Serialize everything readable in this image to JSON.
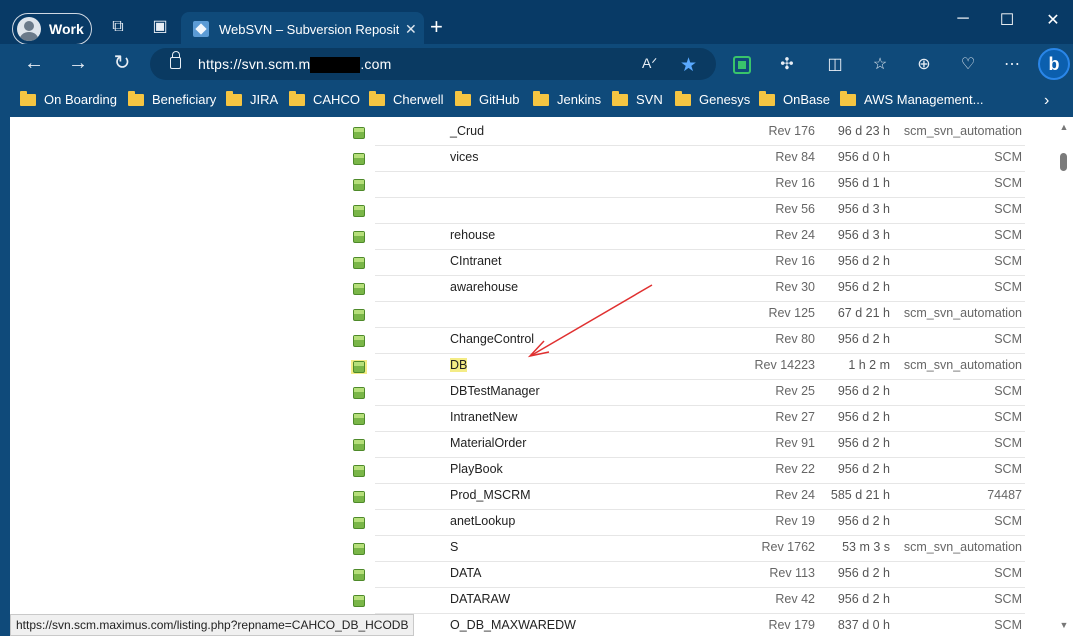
{
  "titlebar": {
    "profile_label": "Work",
    "tab_title": "WebSVN – Subversion Repository",
    "new_tab_icon": "plus-icon",
    "minimize_icon": "minimize-icon",
    "maximize_icon": "maximize-icon",
    "close_icon": "close-icon"
  },
  "toolbar": {
    "url_start": "https://svn.scm.",
    "url_partial": "m",
    "url_end": ".com",
    "icons": [
      "read-aloud-icon",
      "favorite-star-icon",
      "extension-icon",
      "puzzle-icon",
      "split-screen-icon",
      "favorites-icon",
      "collections-icon",
      "heart-icon",
      "more-icon",
      "bing-icon"
    ]
  },
  "bookmarks": [
    {
      "label": "On Boarding"
    },
    {
      "label": "Beneficiary"
    },
    {
      "label": "JIRA"
    },
    {
      "label": "CAHCO"
    },
    {
      "label": "Cherwell"
    },
    {
      "label": "GitHub"
    },
    {
      "label": "Jenkins"
    },
    {
      "label": "SVN"
    },
    {
      "label": "Genesys"
    },
    {
      "label": "OnBase"
    },
    {
      "label": "AWS Management..."
    }
  ],
  "colors": {
    "chrome_bg": "#0f4a7a",
    "titlebar_bg": "#083a66",
    "highlight": "#f4ec86",
    "arrow": "#e03030"
  },
  "repos": [
    {
      "name": "_Crud",
      "rev": "Rev 176",
      "age": "96 d 23 h",
      "author": "scm_svn_automation"
    },
    {
      "name": "vices",
      "rev": "Rev 84",
      "age": "956 d 0 h",
      "author": "SCM"
    },
    {
      "name": "",
      "rev": "Rev 16",
      "age": "956 d 1 h",
      "author": "SCM"
    },
    {
      "name": "",
      "rev": "Rev 56",
      "age": "956 d 3 h",
      "author": "SCM"
    },
    {
      "name": "rehouse",
      "rev": "Rev 24",
      "age": "956 d 3 h",
      "author": "SCM"
    },
    {
      "name": "CIntranet",
      "rev": "Rev 16",
      "age": "956 d 2 h",
      "author": "SCM"
    },
    {
      "name": "awarehouse",
      "rev": "Rev 30",
      "age": "956 d 2 h",
      "author": "SCM"
    },
    {
      "name": "",
      "rev": "Rev 125",
      "age": "67 d 21 h",
      "author": "scm_svn_automation"
    },
    {
      "name": "ChangeControl",
      "rev": "Rev 80",
      "age": "956 d 2 h",
      "author": "SCM"
    },
    {
      "name": "DB",
      "rev": "Rev 14223",
      "age": "1 h 2 m",
      "author": "scm_svn_automation",
      "highlight": true
    },
    {
      "name": "DBTestManager",
      "rev": "Rev 25",
      "age": "956 d 2 h",
      "author": "SCM"
    },
    {
      "name": "IntranetNew",
      "rev": "Rev 27",
      "age": "956 d 2 h",
      "author": "SCM"
    },
    {
      "name": "MaterialOrder",
      "rev": "Rev 91",
      "age": "956 d 2 h",
      "author": "SCM"
    },
    {
      "name": "PlayBook",
      "rev": "Rev 22",
      "age": "956 d 2 h",
      "author": "SCM"
    },
    {
      "name": "Prod_MSCRM",
      "rev": "Rev 24",
      "age": "585 d 21 h",
      "author": "74487"
    },
    {
      "name": "anetLookup",
      "rev": "Rev 19",
      "age": "956 d 2 h",
      "author": "SCM"
    },
    {
      "name": "S",
      "rev": "Rev 1762",
      "age": "53 m 3 s",
      "author": "scm_svn_automation"
    },
    {
      "name": "DATA",
      "rev": "Rev 113",
      "age": "956 d 2 h",
      "author": "SCM"
    },
    {
      "name": "DATARAW",
      "rev": "Rev 42",
      "age": "956 d 2 h",
      "author": "SCM"
    },
    {
      "name": "O_DB_MAXWAREDW",
      "rev": "Rev 179",
      "age": "837 d 0 h",
      "author": "SCM"
    }
  ],
  "status_url": "https://svn.scm.maximus.com/listing.php?repname=CAHCO_DB_HCODB"
}
